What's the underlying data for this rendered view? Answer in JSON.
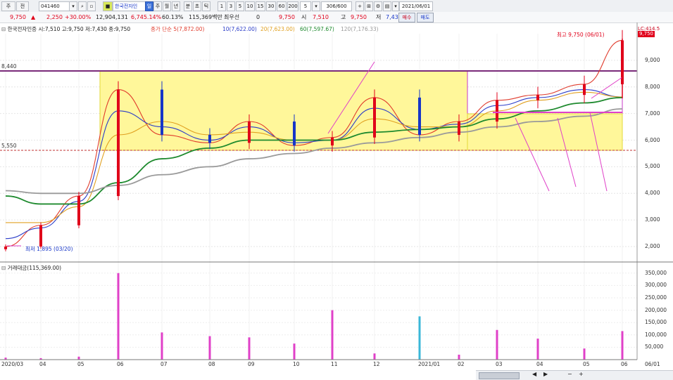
{
  "toolbar": {
    "menu_label": "주",
    "mode_label": "전",
    "code": "041460",
    "name": "한국전자인",
    "period_buttons": [
      "일",
      "주",
      "월",
      "년",
      "분",
      "초",
      "틱"
    ],
    "interval_buttons": [
      "1",
      "3",
      "5",
      "10",
      "15",
      "30",
      "60",
      "200"
    ],
    "count_value": "5",
    "page_value": "306/600",
    "date_value": "2021/06/01",
    "buy_label": "매수",
    "sell_label": "매도"
  },
  "quote": {
    "price": "9,750",
    "change": "2,250",
    "change_pct": "+30.00%",
    "volume": "12,904,131",
    "volume_ratio": "6,745.14%",
    "turnover_pct": "60.13%",
    "amount": "115,369백만",
    "best_label": "최우선",
    "best_value": "0",
    "current": "9,750",
    "open_label": "시",
    "open": "7,510",
    "high_label": "고",
    "high": "9,750",
    "low_label": "저",
    "low": "7,430"
  },
  "legend": {
    "stock": "한국전자인증 시:7,510 고:9,750 저:7,430 종:9,750",
    "ma_label": "종가 단순 5(7,872.00)",
    "ma10": "10(7,622.00)",
    "ma20": "20(7,623.00)",
    "ma60": "60(7,597.67)",
    "ma120": "120(7,176.33)",
    "volume_panel": "거래대금(115,369.00)"
  },
  "annotations": {
    "high_note": "최고 9,750 (06/01)",
    "low_note": "최저 1,895 (03/20)",
    "level_upper": "8,440",
    "level_lower": "5,550",
    "price_tag": "9,750",
    "lc_tag": "LC:414.5"
  },
  "colors": {
    "up": "#e0001a",
    "down": "#1736c8",
    "ma5": "#e03b2c",
    "ma10": "#2a3cc8",
    "ma20": "#e0a020",
    "ma60": "#1e8a2e",
    "ma120": "#9a9a9a",
    "box_fill": "#fff79a",
    "box_border": "#c838c8",
    "volume_bar": "#e040c8"
  },
  "chart_data": [
    {
      "type": "line",
      "title": "한국전자인증 시:7,510 고:9,750 저:7,430 종:9,750",
      "ylim": [
        1500,
        10000
      ],
      "yticks": [
        2000,
        3000,
        4000,
        5000,
        6000,
        7000,
        8000,
        9000
      ],
      "ytick_labels": [
        "2,000",
        "3,000",
        "4,000",
        "5,000",
        "6,000",
        "7,000",
        "8,000",
        "9,000"
      ],
      "x_labels": [
        "2020/03",
        "04",
        "05",
        "06",
        "07",
        "08",
        "09",
        "10",
        "11",
        "12",
        "2021/01",
        "02",
        "03",
        "04",
        "05",
        "06",
        "06/01"
      ],
      "horizontal_levels": [
        8440,
        5550
      ],
      "series": [
        {
          "name": "5",
          "x": [
            "2020/03",
            "04",
            "05",
            "06",
            "07",
            "08",
            "09",
            "10",
            "11",
            "12",
            "2021/01",
            "02",
            "03",
            "04",
            "05",
            "06"
          ],
          "values": [
            2000,
            2800,
            3900,
            7900,
            6200,
            5900,
            6700,
            5800,
            6100,
            7600,
            6200,
            6700,
            7500,
            7700,
            8100,
            9750
          ]
        },
        {
          "name": "10",
          "x": [
            "2020/03",
            "04",
            "05",
            "06",
            "07",
            "08",
            "09",
            "10",
            "11",
            "12",
            "2021/01",
            "02",
            "03",
            "04",
            "05",
            "06"
          ],
          "values": [
            2300,
            2700,
            3700,
            7100,
            6500,
            6000,
            6500,
            5900,
            6000,
            7200,
            6400,
            6600,
            7300,
            7600,
            7900,
            7622
          ]
        },
        {
          "name": "20",
          "x": [
            "2020/03",
            "04",
            "05",
            "06",
            "07",
            "08",
            "09",
            "10",
            "11",
            "12",
            "2021/01",
            "02",
            "03",
            "04",
            "05",
            "06"
          ],
          "values": [
            2900,
            2900,
            3500,
            6200,
            6700,
            6200,
            6300,
            6000,
            6000,
            6800,
            6500,
            6500,
            7100,
            7500,
            7800,
            7623
          ]
        },
        {
          "name": "60",
          "x": [
            "2020/03",
            "04",
            "05",
            "06",
            "07",
            "08",
            "09",
            "10",
            "11",
            "12",
            "2021/01",
            "02",
            "03",
            "04",
            "05",
            "06"
          ],
          "values": [
            3900,
            3600,
            3600,
            4400,
            5300,
            5700,
            6000,
            6000,
            6000,
            6300,
            6400,
            6500,
            6800,
            7100,
            7400,
            7598
          ]
        },
        {
          "name": "120",
          "x": [
            "2020/03",
            "04",
            "05",
            "06",
            "07",
            "08",
            "09",
            "10",
            "11",
            "12",
            "2021/01",
            "02",
            "03",
            "04",
            "05",
            "06"
          ],
          "values": [
            4100,
            4000,
            4000,
            4300,
            4700,
            5000,
            5300,
            5500,
            5700,
            5900,
            6100,
            6300,
            6500,
            6700,
            6900,
            7176
          ]
        }
      ]
    },
    {
      "type": "bar",
      "title": "거래대금(115,369.00)",
      "ylim": [
        0,
        375000
      ],
      "yticks": [
        50000,
        100000,
        150000,
        200000,
        250000,
        300000,
        350000
      ],
      "ytick_labels": [
        "50,000",
        "100,000",
        "150,000",
        "200,000",
        "250,000",
        "300,000",
        "350,000"
      ],
      "categories": [
        "2020/03",
        "04",
        "05",
        "06",
        "07",
        "08",
        "09",
        "10",
        "11",
        "12",
        "2021/01",
        "02",
        "03",
        "04",
        "05",
        "06"
      ],
      "values": [
        8000,
        6000,
        12000,
        350000,
        110000,
        95000,
        90000,
        65000,
        200000,
        25000,
        175000,
        20000,
        120000,
        85000,
        45000,
        115369
      ]
    }
  ]
}
